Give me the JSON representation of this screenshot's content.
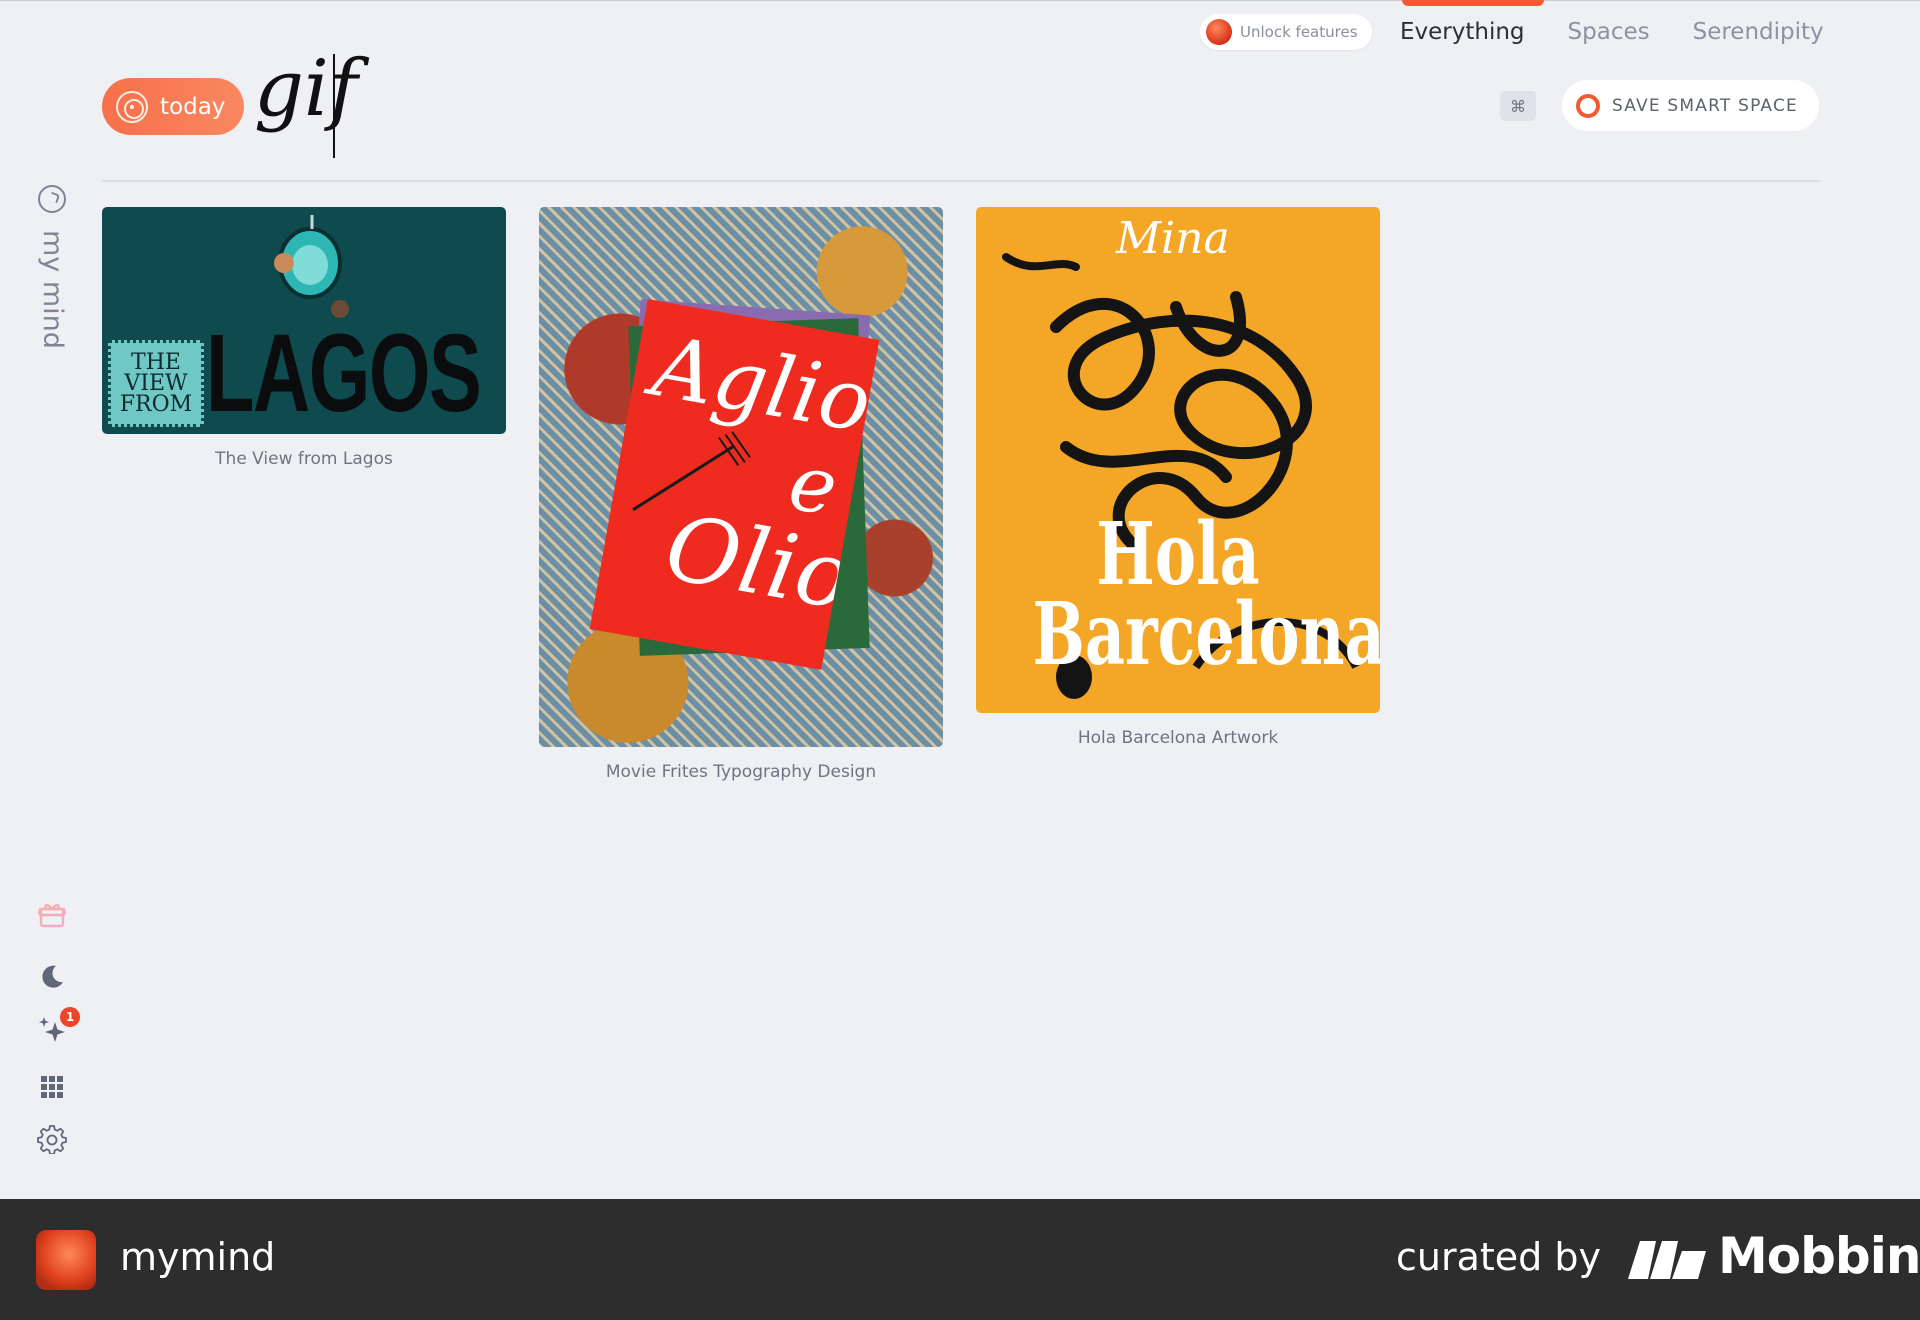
{
  "nav": {
    "unlock_label": "Unlock features",
    "tabs": [
      {
        "label": "Everything",
        "active": true
      },
      {
        "label": "Spaces",
        "active": false
      },
      {
        "label": "Serendipity",
        "active": false
      }
    ]
  },
  "header": {
    "today_label": "today",
    "query": "gif",
    "shortcut_key": "⌘",
    "save_space_label": "SAVE SMART SPACE"
  },
  "sidebar": {
    "label": "my mind",
    "notification_count": "1",
    "icons": [
      "gift-icon",
      "moon-icon",
      "sparkle-icon",
      "grid-icon",
      "gear-icon"
    ]
  },
  "cards": [
    {
      "caption": "The View from Lagos",
      "art": {
        "stamp_lines": [
          "THE",
          "VIEW",
          "FROM"
        ],
        "word": "LAGOS"
      }
    },
    {
      "caption": "Movie Frites Typography Design",
      "art": {
        "line1": "Aglio",
        "line2": "e",
        "line3": "Olio"
      }
    },
    {
      "caption": "Hola Barcelona Artwork",
      "art": {
        "signature": "Mina",
        "line1": "Hola",
        "line2": "Barcelona!"
      }
    }
  ],
  "footer": {
    "app_name": "mymind",
    "curated_by": "curated by",
    "brand": "Mobbin"
  },
  "colors": {
    "accent": "#f25a32",
    "background": "#eff0f3",
    "footer": "#2d2d2d"
  }
}
